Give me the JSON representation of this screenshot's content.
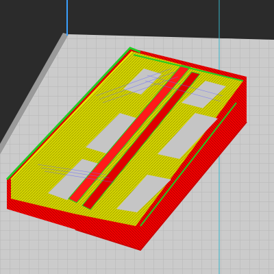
{
  "app": {
    "view": "slicer-gcode-preview",
    "background_color": "#2b2b2b",
    "bed_color": "#c9c9c9",
    "bed_grid_color": "#b3b3b3"
  },
  "gcode_preview": {
    "feature_colors": {
      "outer_wall": "#ff0000",
      "inner_wall": "#22cc22",
      "top_solid_infill": "#e8e800",
      "sparse_infill": "#b8b800",
      "travel_moves": "#6a6aff"
    },
    "axis_colors": {
      "z_axis": "#3aa0ff",
      "vertical_guide": "#35b6c9"
    },
    "icons": [
      "build-plate-icon",
      "z-axis-icon"
    ]
  }
}
